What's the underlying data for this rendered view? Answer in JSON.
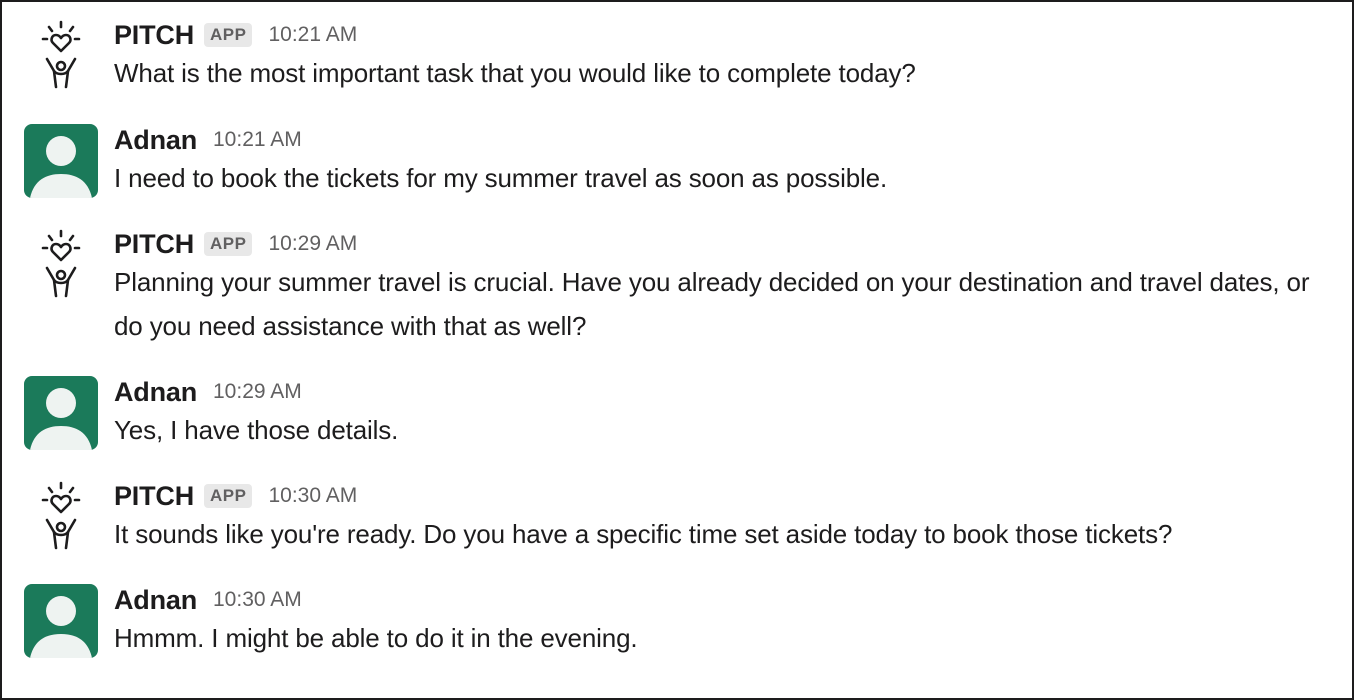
{
  "messages": [
    {
      "sender": "PITCH",
      "badge": "APP",
      "time": "10:21 AM",
      "kind": "bot",
      "avatar_icon": "pitch-logo-icon",
      "text": "What is the most important task that you would like to complete today?"
    },
    {
      "sender": "Adnan",
      "badge": "",
      "time": "10:21 AM",
      "kind": "user",
      "avatar_icon": "default-user-avatar-icon",
      "text": "I need to book the tickets for my summer travel as soon as possible."
    },
    {
      "sender": "PITCH",
      "badge": "APP",
      "time": "10:29 AM",
      "kind": "bot",
      "avatar_icon": "pitch-logo-icon",
      "text": "Planning your summer travel is crucial. Have you already decided on your destination and travel dates, or do you need assistance with that as well?"
    },
    {
      "sender": "Adnan",
      "badge": "",
      "time": "10:29 AM",
      "kind": "user",
      "avatar_icon": "default-user-avatar-icon",
      "text": "Yes, I have those details."
    },
    {
      "sender": "PITCH",
      "badge": "APP",
      "time": "10:30 AM",
      "kind": "bot",
      "avatar_icon": "pitch-logo-icon",
      "text": "It sounds like you're ready. Do you have a specific time set aside today to book those tickets?"
    },
    {
      "sender": "Adnan",
      "badge": "",
      "time": "10:30 AM",
      "kind": "user",
      "avatar_icon": "default-user-avatar-icon",
      "text": "Hmmm. I might be able to do it in the evening."
    }
  ],
  "colors": {
    "user_avatar_bg": "#1b7a5a",
    "user_avatar_fg": "#eef3f1",
    "text": "#1d1c1d",
    "muted": "#616061",
    "badge_bg": "#e8e8e8"
  }
}
